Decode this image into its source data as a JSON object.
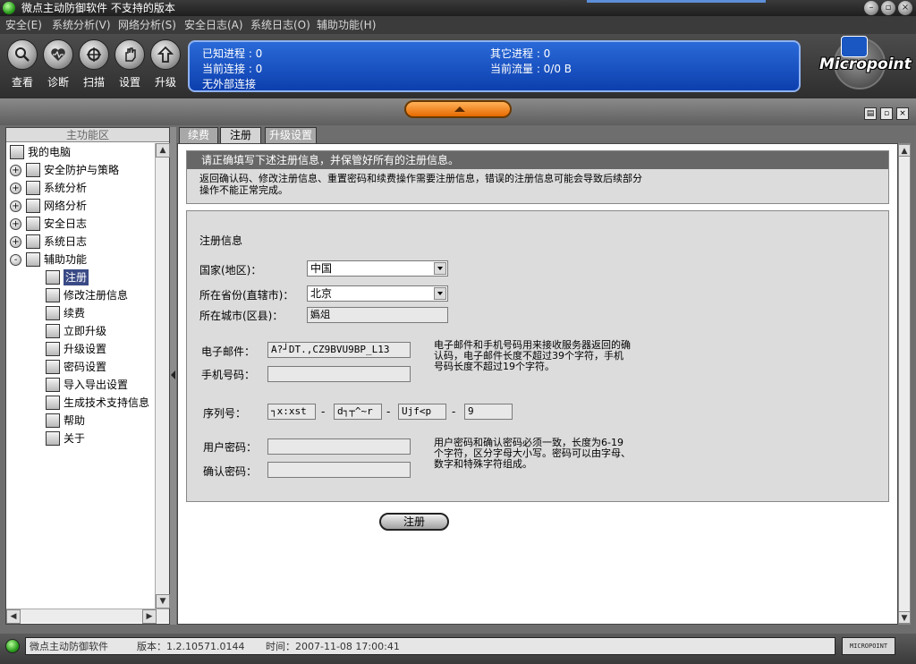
{
  "window": {
    "title": "微点主动防御软件  不支持的版本",
    "controls": [
      "minimize",
      "restore",
      "close"
    ]
  },
  "menu": [
    {
      "label": "安全(E)"
    },
    {
      "label": "系统分析(V)"
    },
    {
      "label": "网络分析(S)"
    },
    {
      "label": "安全日志(A)"
    },
    {
      "label": "系统日志(O)"
    },
    {
      "label": "辅助功能(H)"
    }
  ],
  "toolbar": {
    "buttons": [
      {
        "label": "查看",
        "icon": "magnifier-icon"
      },
      {
        "label": "诊断",
        "icon": "heart-icon"
      },
      {
        "label": "扫描",
        "icon": "scan-icon"
      },
      {
        "label": "设置",
        "icon": "hand-icon"
      },
      {
        "label": "升级",
        "icon": "upgrade-icon"
      }
    ]
  },
  "status_panel": {
    "known_processes": "已知进程 : 0",
    "other_processes": "其它进程 : 0",
    "current_connections": "当前连接 : 0",
    "current_traffic": "当前流量 : 0/0 B",
    "external_connections": "无外部连接"
  },
  "logo": {
    "text": "Micropoint"
  },
  "left_panel": {
    "header": "主功能区",
    "tree": [
      {
        "label": "我的电脑",
        "level": 0,
        "expander": ""
      },
      {
        "label": "安全防护与策略",
        "level": 1,
        "expander": "+"
      },
      {
        "label": "系统分析",
        "level": 1,
        "expander": "+"
      },
      {
        "label": "网络分析",
        "level": 1,
        "expander": "+"
      },
      {
        "label": "安全日志",
        "level": 1,
        "expander": "+"
      },
      {
        "label": "系统日志",
        "level": 1,
        "expander": "+"
      },
      {
        "label": "辅助功能",
        "level": 1,
        "expander": "-"
      },
      {
        "label": "注册",
        "level": 2,
        "expander": "",
        "selected": true
      },
      {
        "label": "修改注册信息",
        "level": 2,
        "expander": ""
      },
      {
        "label": "续费",
        "level": 2,
        "expander": ""
      },
      {
        "label": "立即升级",
        "level": 2,
        "expander": ""
      },
      {
        "label": "升级设置",
        "level": 2,
        "expander": ""
      },
      {
        "label": "密码设置",
        "level": 2,
        "expander": ""
      },
      {
        "label": "导入导出设置",
        "level": 2,
        "expander": ""
      },
      {
        "label": "生成技术支持信息",
        "level": 2,
        "expander": ""
      },
      {
        "label": "帮助",
        "level": 2,
        "expander": ""
      },
      {
        "label": "关于",
        "level": 2,
        "expander": ""
      }
    ]
  },
  "tabs": [
    {
      "label": "续费",
      "active": false
    },
    {
      "label": "注册",
      "active": true
    },
    {
      "label": "升级设置",
      "active": false
    }
  ],
  "notice": {
    "header": "请正确填写下述注册信息，并保管好所有的注册信息。",
    "description": "返回确认码、修改注册信息、重置密码和续费操作需要注册信息，错误的注册信息可能会导致后续部分操作不能正常完成。"
  },
  "form": {
    "section_title": "注册信息",
    "country_label": "国家(地区)：",
    "country_value": "中国",
    "province_label": "所在省份(直辖市)：",
    "province_value": "北京",
    "city_label": "所在城市(区县)：",
    "city_value": "嬀俎",
    "email_label": "电子邮件：",
    "email_value": "A?┘DT.,CZ9BVU9BP_L13",
    "phone_label": "手机号码：",
    "phone_value": "",
    "contact_hint": "电子邮件和手机号码用来接收服务器返回的确认码，电子邮件长度不超过39个字符，手机号码长度不超过19个字符。",
    "serial_label": "序列号：",
    "serial_parts": [
      "┐x:xst",
      "d┐┬^~r",
      "Ujf<p",
      "9"
    ],
    "serial_sep": "-",
    "password_label": "用户密码：",
    "password_value": "",
    "confirm_label": "确认密码：",
    "confirm_value": "",
    "password_hint": "用户密码和确认密码必须一致，长度为6-19个字符，区分字母大小写。密码可以由字母、数字和特殊字符组成。",
    "submit_label": "注册"
  },
  "statusbar": {
    "app_name": "微点主动防御软件",
    "version": "版本：1.2.10571.0144",
    "time": "时间：2007-11-08 17:00:41",
    "brand": "MICROPOINT"
  }
}
